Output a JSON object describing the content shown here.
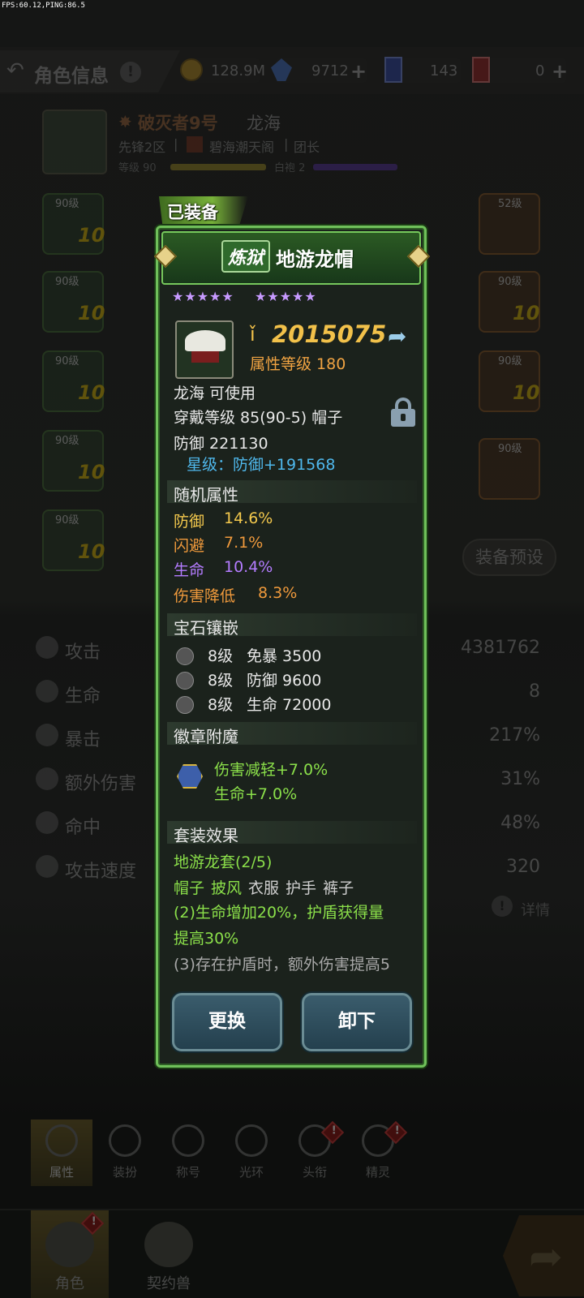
{
  "status": {
    "fps": "FPS:60.12,PING:86.5"
  },
  "header": {
    "title": "角色信息",
    "gold": "128.9M",
    "gems": "9712",
    "card_a": "143",
    "card_b": "0"
  },
  "player": {
    "title_name": "破灭者9号",
    "name": "龙海",
    "server": "先锋2区",
    "guild": "碧海潮天阁",
    "guild_role": "团长",
    "level_label": "等级 90",
    "robe_label": "白袍 2"
  },
  "slots_left": [
    {
      "level": "90级",
      "badge": "10"
    },
    {
      "level": "90级",
      "badge": "10"
    },
    {
      "level": "90级",
      "badge": "10"
    },
    {
      "level": "90级",
      "badge": "10"
    },
    {
      "level": "90级",
      "badge": "10"
    }
  ],
  "slots_right": [
    {
      "level": "52级",
      "badge": ""
    },
    {
      "level": "90级",
      "badge": "10"
    },
    {
      "level": "90级",
      "badge": "10"
    },
    {
      "level": "90级",
      "badge": ""
    }
  ],
  "preset_label": "装备预设",
  "stats": [
    {
      "label": "攻击",
      "value": "4381762"
    },
    {
      "label": "生命",
      "value": "8"
    },
    {
      "label": "暴击",
      "value": "217%"
    },
    {
      "label": "额外伤害",
      "value": "31%"
    },
    {
      "label": "命中",
      "value": "48%"
    },
    {
      "label": "攻击速度",
      "value": "320"
    }
  ],
  "detail_label": "详情",
  "popup": {
    "equipped_tag": "已装备",
    "tier": "炼狱",
    "item_name": "地游龙帽",
    "stars_left": "★★★★★",
    "stars_right": "★★★★★",
    "power": "2015075",
    "attr_level": "属性等级 180",
    "usable": "龙海 可使用",
    "wear": "穿戴等级 85(90-5) 帽子",
    "defense": "防御  221130",
    "star_bonus": "星级：防御+191568",
    "random_title": "随机属性",
    "random": [
      {
        "name": "防御",
        "value": "14.6%",
        "color": "#f4c94d"
      },
      {
        "name": "闪避",
        "value": "7.1%",
        "color": "#f09a3c"
      },
      {
        "name": "生命",
        "value": "10.4%",
        "color": "#b47cff"
      },
      {
        "name": "伤害降低",
        "value": "8.3%",
        "color": "#f09a3c"
      }
    ],
    "gem_title": "宝石镶嵌",
    "gems": [
      {
        "level": "8级",
        "effect": "免暴 3500"
      },
      {
        "level": "8级",
        "effect": "防御 9600"
      },
      {
        "level": "8级",
        "effect": "生命 72000"
      }
    ],
    "badge_title": "徽章附魔",
    "badge_lines": [
      "伤害减轻+7.0%",
      "生命+7.0%"
    ],
    "set_title": "套装效果",
    "set_name": "地游龙套(2/5)",
    "set_parts": [
      {
        "label": "帽子",
        "owned": true
      },
      {
        "label": "披风",
        "owned": true
      },
      {
        "label": "衣服",
        "owned": false
      },
      {
        "label": "护手",
        "owned": false
      },
      {
        "label": "裤子",
        "owned": false
      }
    ],
    "set_bonus_2_a": "(2)生命增加20%，护盾获得量",
    "set_bonus_2_b": "提高30%",
    "set_bonus_3": "(3)存在护盾时，额外伤害提高5",
    "btn_replace": "更换",
    "btn_unequip": "卸下"
  },
  "tabs": [
    {
      "label": "属性",
      "active": true,
      "alert": false
    },
    {
      "label": "装扮",
      "active": false,
      "alert": false
    },
    {
      "label": "称号",
      "active": false,
      "alert": false
    },
    {
      "label": "光环",
      "active": false,
      "alert": false
    },
    {
      "label": "头衔",
      "active": false,
      "alert": true
    },
    {
      "label": "精灵",
      "active": false,
      "alert": true
    }
  ],
  "nav": [
    {
      "label": "角色",
      "active": true,
      "alert": true
    },
    {
      "label": "契约兽",
      "active": false,
      "alert": false
    }
  ]
}
